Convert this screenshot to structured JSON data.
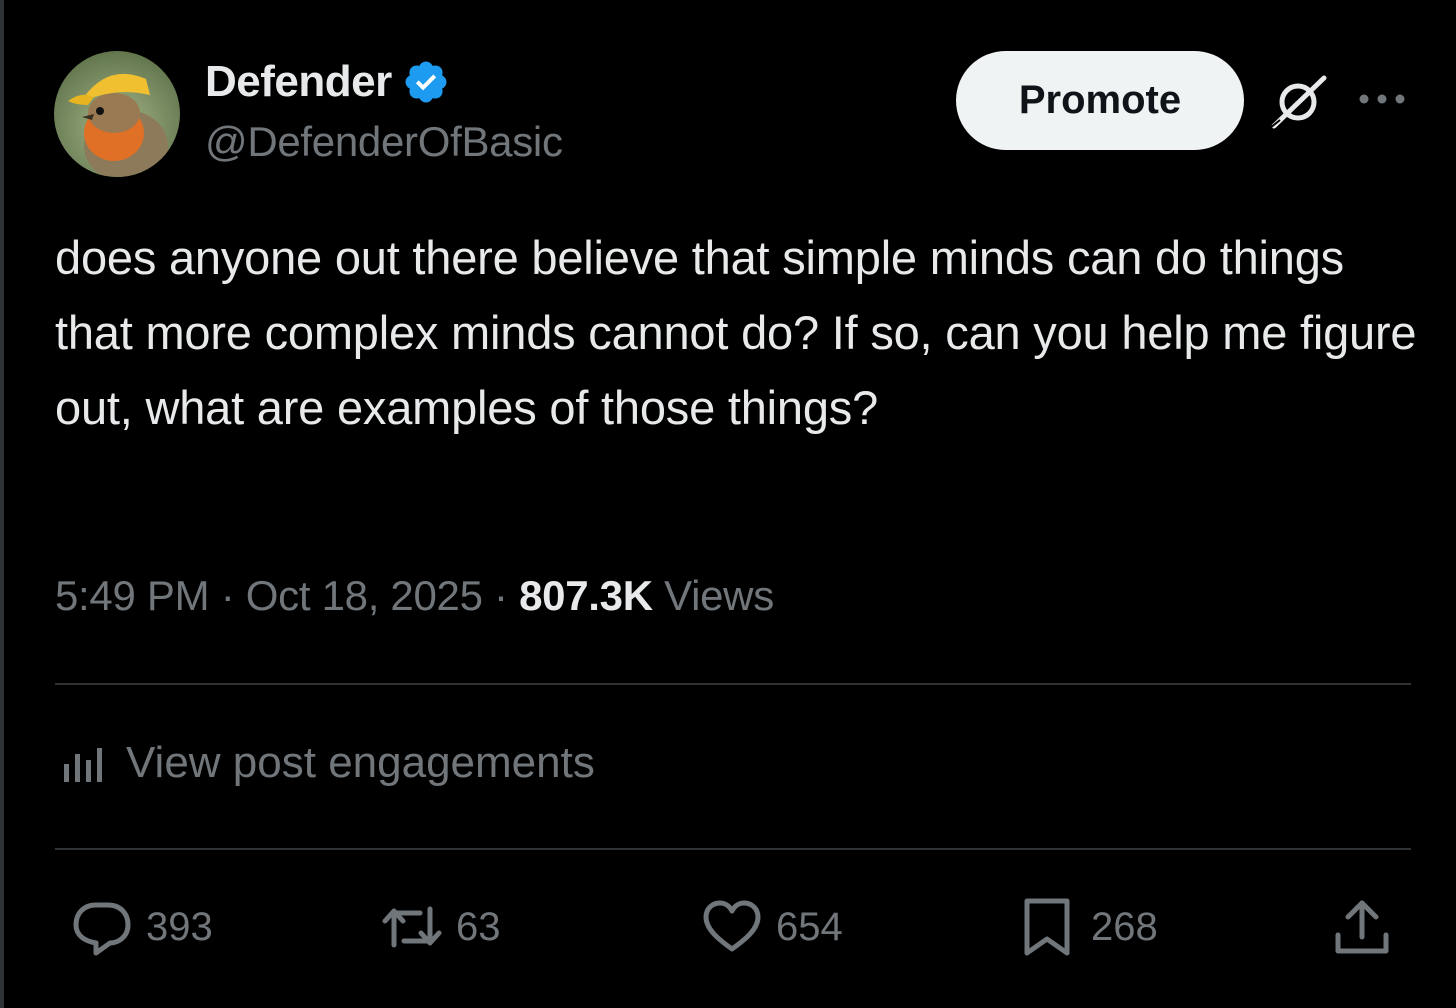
{
  "author": {
    "display_name": "Defender",
    "handle": "@DefenderOfBasic",
    "verified": true
  },
  "header": {
    "promote_label": "Promote",
    "grok_icon": "grok-icon",
    "more_icon": "more-icon"
  },
  "tweet": {
    "text": "does anyone out there believe that simple minds can do things that more complex minds cannot do? If so, can you help me figure out, what are examples of those things?",
    "time": "5:49 PM",
    "date": "Oct 18, 2025",
    "views_count": "807.3K",
    "views_label": "Views",
    "separator": "·"
  },
  "engagements": {
    "label": "View post engagements"
  },
  "actions": {
    "replies": "393",
    "reposts": "63",
    "likes": "654",
    "bookmarks": "268"
  },
  "colors": {
    "background": "#000000",
    "text": "#e7e9ea",
    "muted": "#71767b",
    "divider": "#2f3336",
    "verified": "#1d9bf0",
    "promote_bg": "#eff3f4"
  }
}
